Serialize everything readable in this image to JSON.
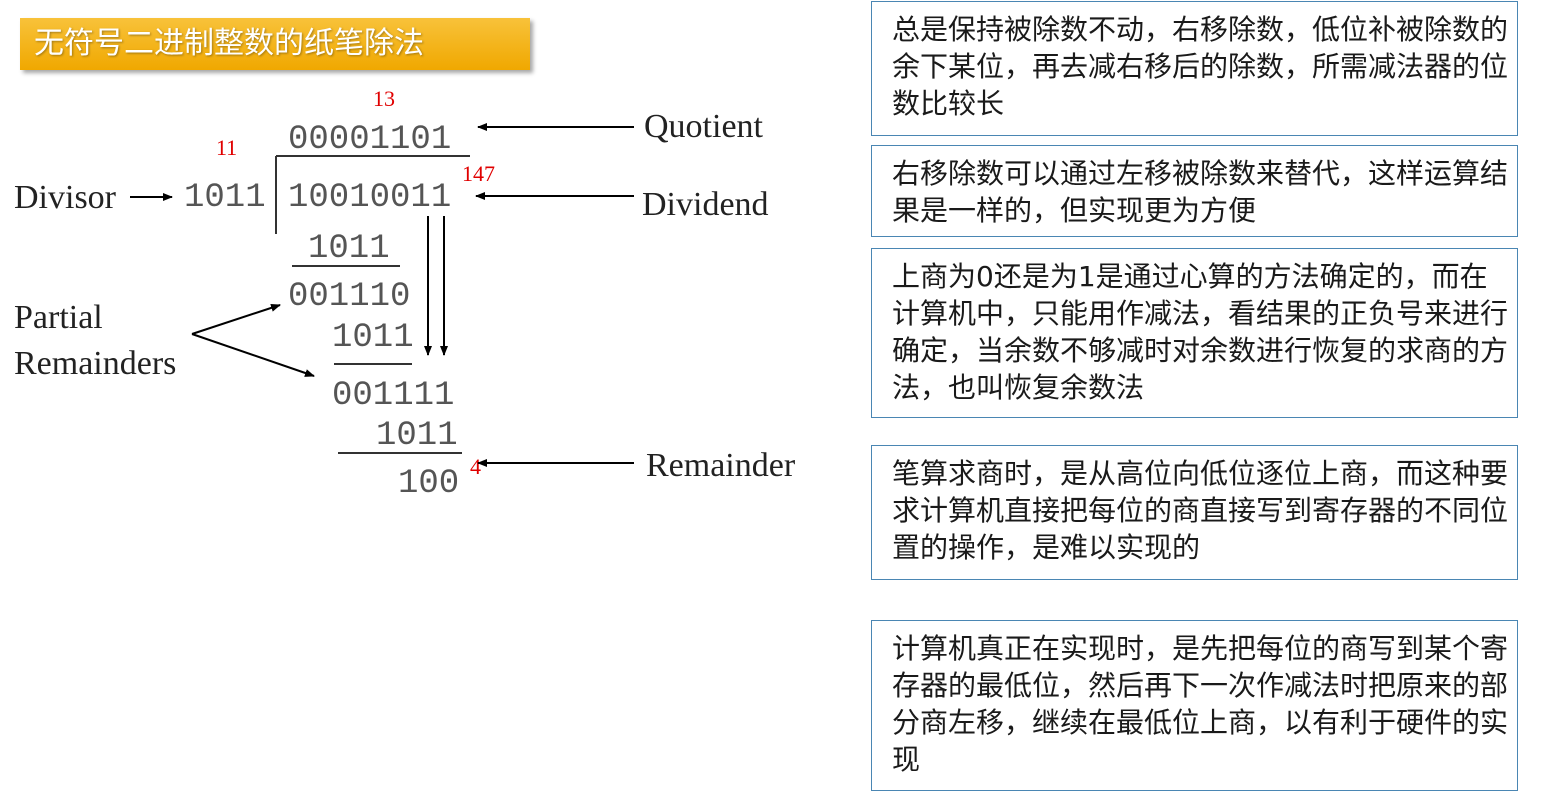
{
  "title": "无符号二进制整数的纸笔除法",
  "diagram": {
    "quotient_decimal": "13",
    "divisor_decimal": "11",
    "dividend_decimal": "147",
    "remainder_decimal": "4",
    "quotient_bits": "00001101",
    "divisor_bits": "1011",
    "dividend_bits": "10010011",
    "step1_subtrahend": "1011",
    "step1_partial": "001110",
    "step2_subtrahend": "1011",
    "step2_partial": "001111",
    "step3_subtrahend": "1011",
    "remainder_bits": "100",
    "label_quotient": "Quotient",
    "label_divisor": "Divisor",
    "label_dividend": "Dividend",
    "label_partial_line1": "Partial",
    "label_partial_line2": "Remainders",
    "label_remainder": "Remainder"
  },
  "colors": {
    "title_background": "#f0a800",
    "title_text": "#ffffff",
    "annotation_red": "#e00000",
    "note_border": "#4a86b3"
  },
  "notes": [
    "总是保持被除数不动，右移除数，低位补被除数的余下某位，再去减右移后的除数，所需减法器的位数比较长",
    "右移除数可以通过左移被除数来替代，这样运算结果是一样的，但实现更为方便",
    "上商为0还是为1是通过心算的方法确定的，而在计算机中，只能用作减法，看结果的正负号来进行确定，当余数不够减时对余数进行恢复的求商的方法，也叫恢复余数法",
    "笔算求商时，是从高位向低位逐位上商，而这种要求计算机直接把每位的商直接写到寄存器的不同位置的操作，是难以实现的",
    "计算机真正在实现时，是先把每位的商写到某个寄存器的最低位，然后再下一次作减法时把原来的部分商左移，继续在最低位上商，以有利于硬件的实现"
  ]
}
